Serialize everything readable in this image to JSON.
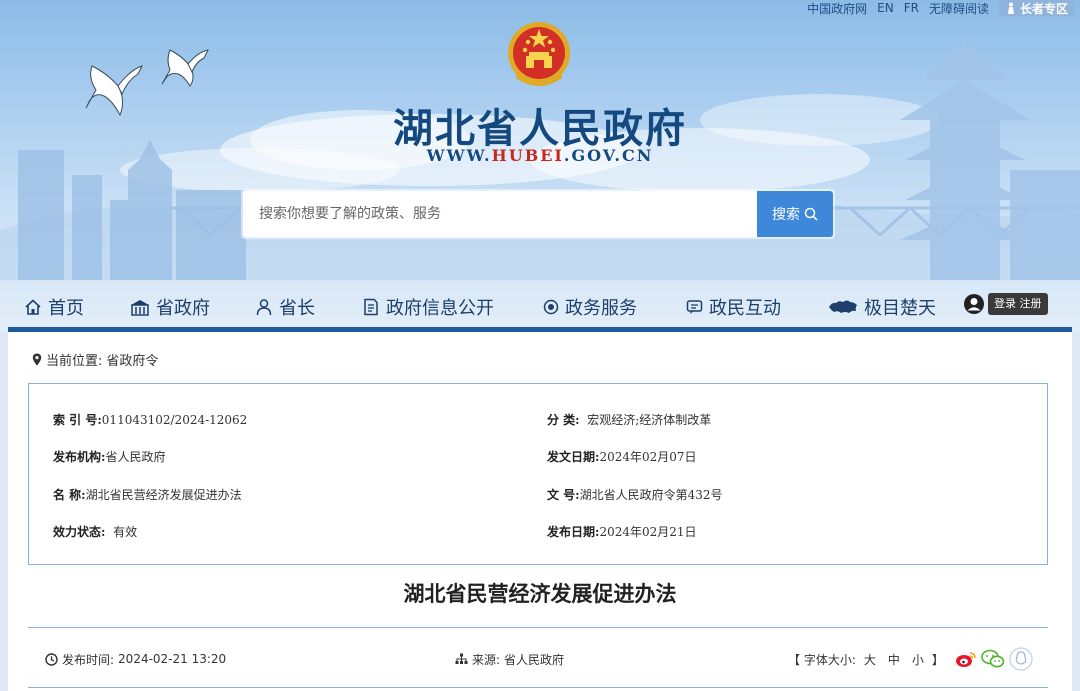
{
  "toplinks": {
    "gov_portal": "中国政府网",
    "english": "EN",
    "french": "FR",
    "accessible": "无障碍阅读",
    "elder": "长者专区"
  },
  "site": {
    "title": "湖北省人民政府",
    "url_prefix": "WWW.",
    "url_highlight": "HUBEI",
    "url_suffix": ".GOV.CN"
  },
  "search": {
    "placeholder": "搜索你想要了解的政策、服务",
    "button": "搜索"
  },
  "nav": {
    "items": [
      {
        "label": "首页",
        "icon": "home-icon"
      },
      {
        "label": "省政府",
        "icon": "building-icon"
      },
      {
        "label": "省长",
        "icon": "person-icon"
      },
      {
        "label": "政府信息公开",
        "icon": "document-icon"
      },
      {
        "label": "政务服务",
        "icon": "service-icon"
      },
      {
        "label": "政民互动",
        "icon": "chat-icon"
      },
      {
        "label": "极目楚天",
        "icon": "hubei-map-icon"
      }
    ],
    "login": "登录",
    "register": "注册"
  },
  "breadcrumb": {
    "label": "当前位置:",
    "current": "省政府令"
  },
  "meta": {
    "index_key": "索 引 号:",
    "index_val": "011043102/2024-12062",
    "category_key": "分  类:",
    "category_val": "宏观经济;经济体制改革",
    "issuer_key": "发布机构:",
    "issuer_val": "省人民政府",
    "date_written_key": "发文日期:",
    "date_written_val": "2024年02月07日",
    "name_key": "名  称:",
    "name_val": "湖北省民营经济发展促进办法",
    "doc_no_key": "文  号:",
    "doc_no_val": "湖北省人民政府令第432号",
    "status_key": "效力状态:",
    "status_val": "有效",
    "publish_date_key": "发布日期:",
    "publish_date_val": "2024年02月21日"
  },
  "document": {
    "title": "湖北省民营经济发展促进办法"
  },
  "info": {
    "time_label": "发布时间:",
    "time_val": "2024-02-21 13:20",
    "source_label": "来源:",
    "source_val": "省人民政府",
    "font_open": "【 字体大小:",
    "size_large": "大",
    "size_medium": "中",
    "size_small": "小",
    "font_close": "】"
  },
  "colors": {
    "brand": "#14497f",
    "accent": "#3f87d9",
    "url_highlight": "#c7271f",
    "nav_rule": "#1f5aa0"
  }
}
